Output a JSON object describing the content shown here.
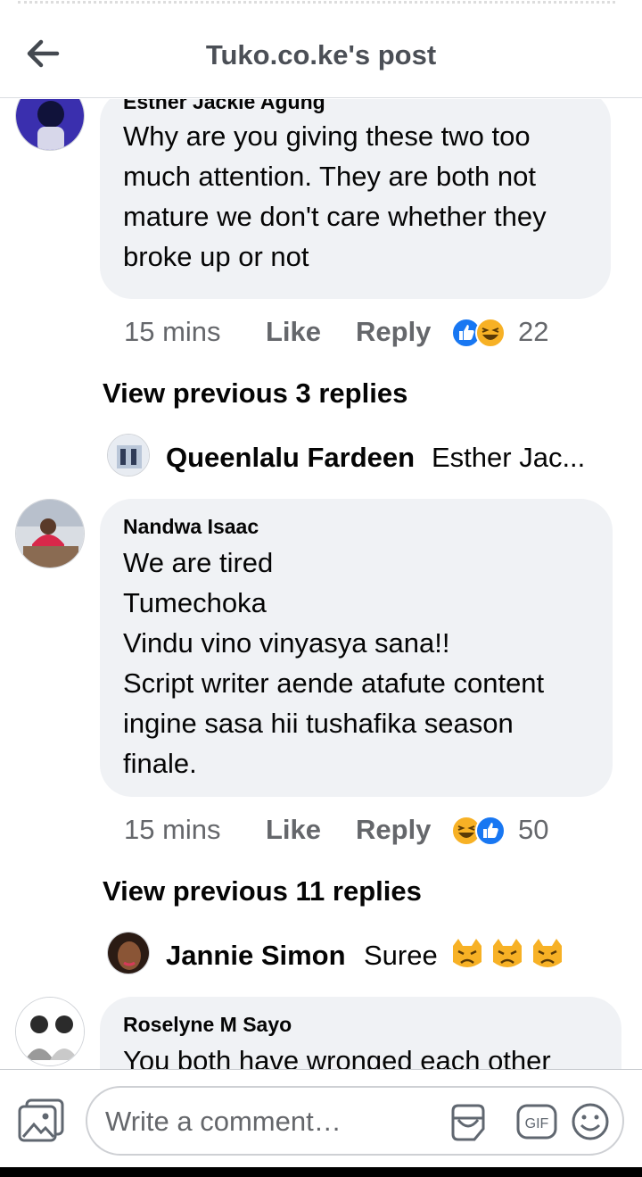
{
  "header": {
    "title": "Tuko.co.ke's post"
  },
  "comments": [
    {
      "author": "Esther Jackie Agung",
      "lines": [
        "Why are you giving these two too",
        "much attention. They are both not",
        "mature we don't care whether they",
        "broke up or not"
      ],
      "time": "15 mins",
      "like": "Like",
      "reply": "Reply",
      "reactions": [
        "like",
        "haha"
      ],
      "count": "22",
      "view_previous": "View previous 3 replies",
      "latest_reply": {
        "name": "Queenlalu Fardeen",
        "text": "Esther Jac..."
      }
    },
    {
      "author": "Nandwa Isaac",
      "lines": [
        "We are tired",
        "Tumechoka",
        "Vindu vino vinyasya sana!!",
        "Script writer aende atafute content",
        "ingine sasa hii tushafika season",
        "finale."
      ],
      "time": "15 mins",
      "like": "Like",
      "reply": "Reply",
      "reactions": [
        "haha",
        "like"
      ],
      "count": "50",
      "view_previous": "View previous 11 replies",
      "latest_reply": {
        "name": "Jannie Simon",
        "text": "Suree"
      }
    },
    {
      "author": "Roselyne M Sayo",
      "lines": [
        "You both have wronged each other"
      ]
    }
  ],
  "composer": {
    "placeholder": "Write a comment…"
  },
  "icons": [
    "back-arrow-icon",
    "like-reaction-icon",
    "haha-reaction-icon",
    "angry-cat-emoji-icon",
    "photo-icon",
    "sticker-icon",
    "gif-icon",
    "emoji-icon"
  ],
  "colors": {
    "like_blue": "#1877f2",
    "bubble": "#f0f2f5",
    "meta_gray": "#65676b"
  }
}
